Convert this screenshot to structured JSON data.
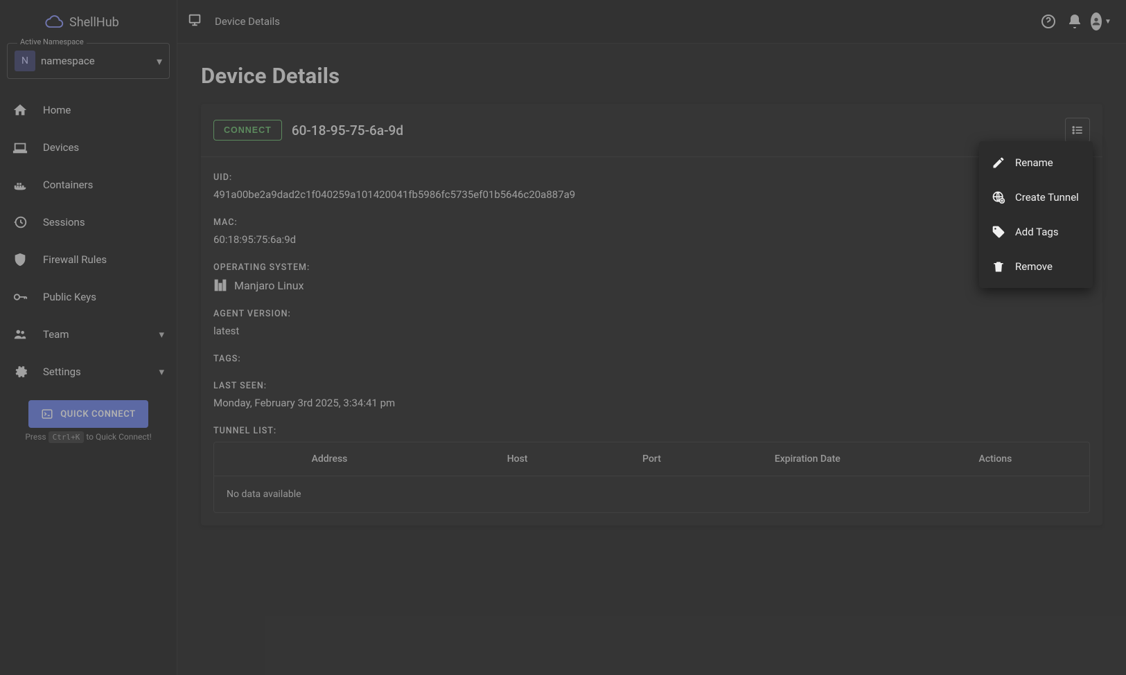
{
  "app": {
    "name": "ShellHub"
  },
  "namespace": {
    "legend": "Active Namespace",
    "initial": "N",
    "name": "namespace"
  },
  "sidebar": {
    "items": [
      {
        "label": "Home",
        "icon": "home-icon"
      },
      {
        "label": "Devices",
        "icon": "laptop-icon"
      },
      {
        "label": "Containers",
        "icon": "container-icon"
      },
      {
        "label": "Sessions",
        "icon": "history-icon"
      },
      {
        "label": "Firewall Rules",
        "icon": "shield-icon"
      },
      {
        "label": "Public Keys",
        "icon": "key-icon"
      },
      {
        "label": "Team",
        "icon": "group-icon",
        "expandable": true
      },
      {
        "label": "Settings",
        "icon": "gear-icon",
        "expandable": true
      }
    ],
    "quick_connect": "QUICK CONNECT",
    "hint_pre": "Press",
    "hint_kbd": "Ctrl+K",
    "hint_post": "to Quick Connect!"
  },
  "topbar": {
    "crumb": "Device Details"
  },
  "page": {
    "title": "Device Details",
    "connect_label": "CONNECT",
    "device_name": "60-18-95-75-6a-9d"
  },
  "details": {
    "uid_label": "UID:",
    "uid_value": "491a00be2a9dad2c1f040259a101420041fb5986fc5735ef01b5646c20a887a9",
    "mac_label": "MAC:",
    "mac_value": "60:18:95:75:6a:9d",
    "os_label": "OPERATING SYSTEM:",
    "os_value": "Manjaro Linux",
    "agent_label": "AGENT VERSION:",
    "agent_value": "latest",
    "tags_label": "TAGS:",
    "last_seen_label": "LAST SEEN:",
    "last_seen_value": "Monday, February 3rd 2025, 3:34:41 pm",
    "tunnel_label": "TUNNEL LIST:"
  },
  "tunnel_table": {
    "headers": {
      "address": "Address",
      "host": "Host",
      "port": "Port",
      "expiration": "Expiration Date",
      "actions": "Actions"
    },
    "empty": "No data available"
  },
  "dropdown": {
    "rename": "Rename",
    "create_tunnel": "Create Tunnel",
    "add_tags": "Add Tags",
    "remove": "Remove"
  },
  "colors": {
    "accent": "#667eea",
    "success": "#66bb6a"
  }
}
